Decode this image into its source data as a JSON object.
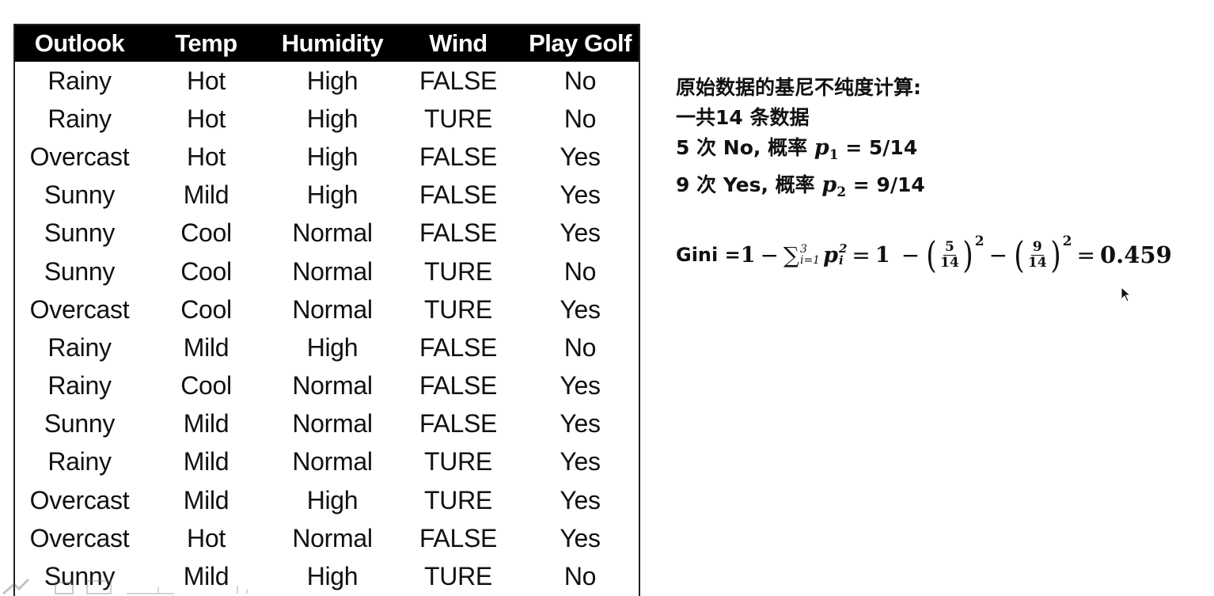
{
  "table": {
    "headers": [
      "Outlook",
      "Temp",
      "Humidity",
      "Wind",
      "Play Golf"
    ],
    "rows": [
      [
        "Rainy",
        "Hot",
        "High",
        "FALSE",
        "No"
      ],
      [
        "Rainy",
        "Hot",
        "High",
        "TURE",
        "No"
      ],
      [
        "Overcast",
        "Hot",
        "High",
        "FALSE",
        "Yes"
      ],
      [
        "Sunny",
        "Mild",
        "High",
        "FALSE",
        "Yes"
      ],
      [
        "Sunny",
        "Cool",
        "Normal",
        "FALSE",
        "Yes"
      ],
      [
        "Sunny",
        "Cool",
        "Normal",
        "TURE",
        "No"
      ],
      [
        "Overcast",
        "Cool",
        "Normal",
        "TURE",
        "Yes"
      ],
      [
        "Rainy",
        "Mild",
        "High",
        "FALSE",
        "No"
      ],
      [
        "Rainy",
        "Cool",
        "Normal",
        "FALSE",
        "Yes"
      ],
      [
        "Sunny",
        "Mild",
        "Normal",
        "FALSE",
        "Yes"
      ],
      [
        "Rainy",
        "Mild",
        "Normal",
        "TURE",
        "Yes"
      ],
      [
        "Overcast",
        "Mild",
        "High",
        "TURE",
        "Yes"
      ],
      [
        "Overcast",
        "Hot",
        "Normal",
        "FALSE",
        "Yes"
      ],
      [
        "Sunny",
        "Mild",
        "High",
        "TURE",
        "No"
      ]
    ]
  },
  "notes": {
    "title": "原始数据的基尼不纯度计算:",
    "total": "一共14 条数据",
    "no_prefix": "5 次 No,  概率 ",
    "no_var": "p",
    "no_sub": "1",
    "no_value": " = 5/14",
    "yes_prefix": "9 次 Yes, 概率 ",
    "yes_var": "p",
    "yes_sub": "2",
    "yes_value": " = 9/14"
  },
  "formula": {
    "label": "Gini = ",
    "one": "1",
    "minus": "−",
    "sum_symbol": "∑",
    "sum_upper": "3",
    "sum_lower": "i=1",
    "p_var": "p",
    "p_sup": "2",
    "p_sub": "i",
    "equals": "=",
    "one_b": "1",
    "frac1_num": "5",
    "frac1_den": "14",
    "frac2_num": "9",
    "frac2_den": "14",
    "square": "2",
    "result": "0.459"
  }
}
